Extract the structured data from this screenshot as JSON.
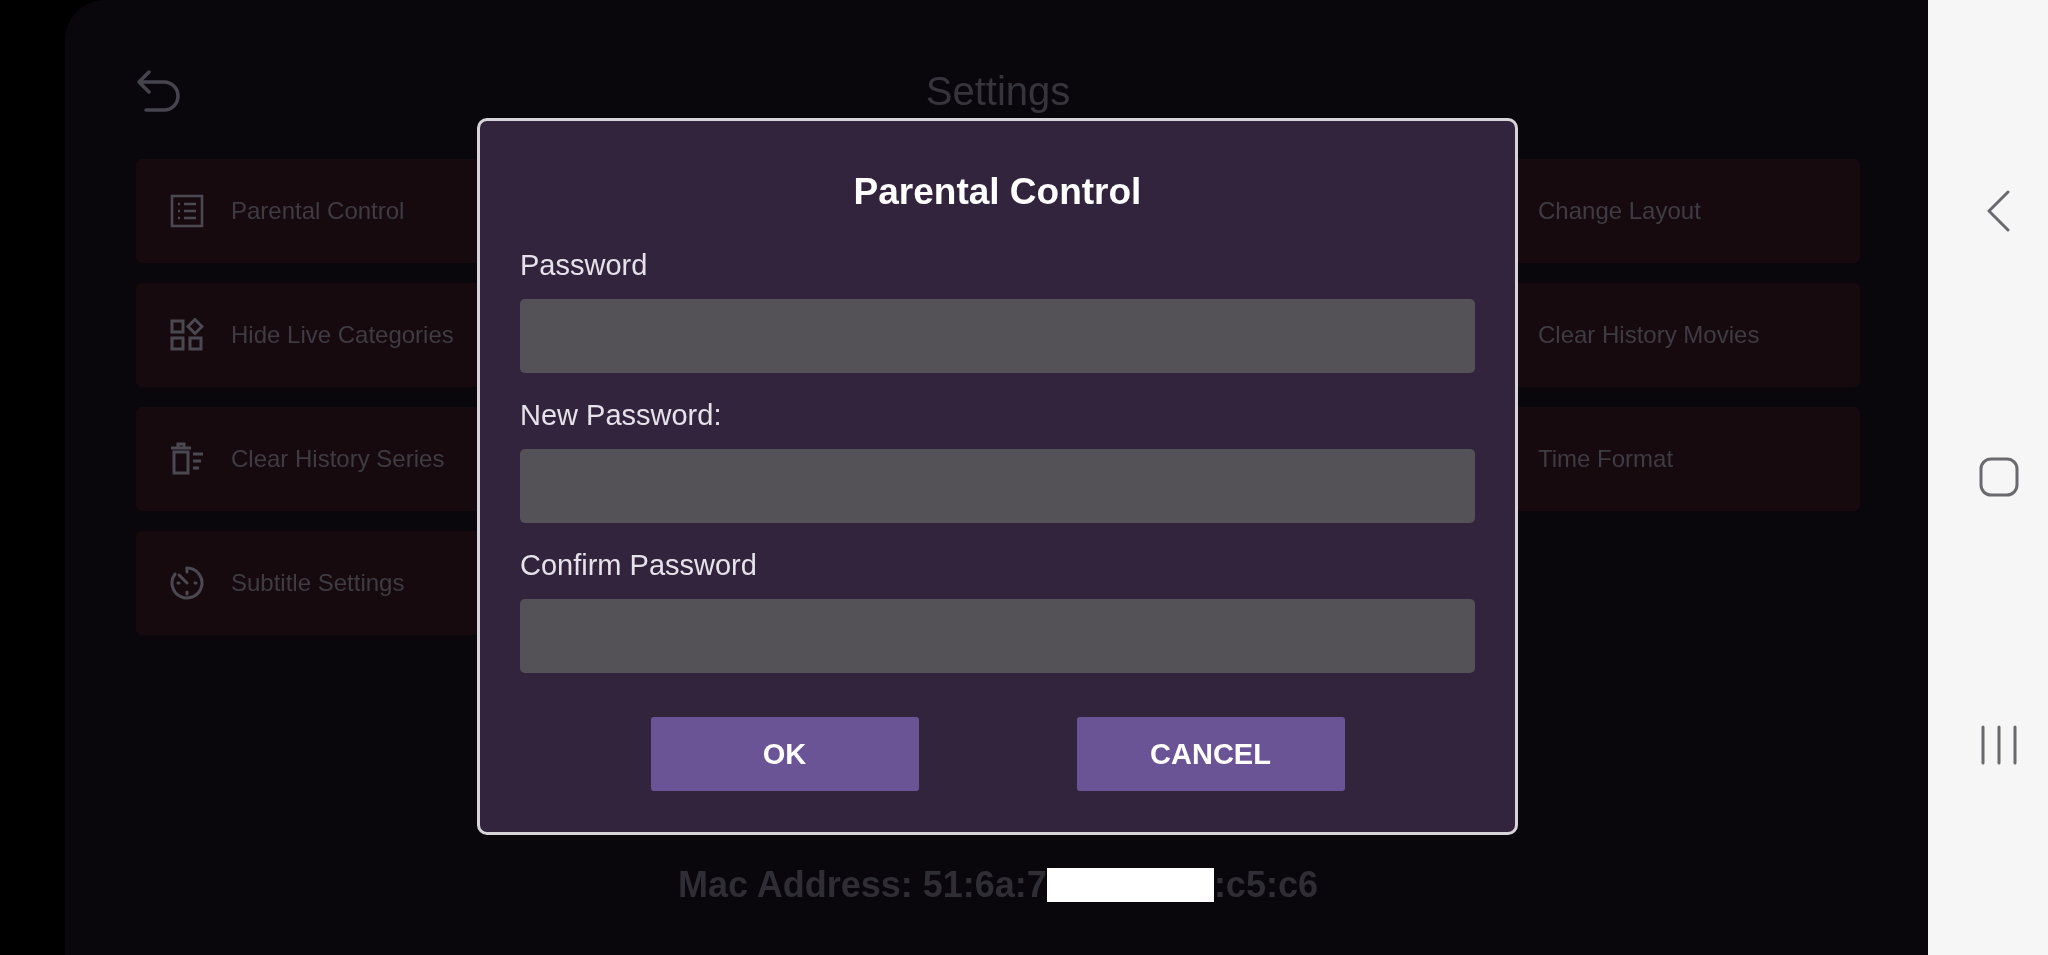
{
  "screen": {
    "title": "Settings"
  },
  "settings": {
    "columns": [
      {
        "items": [
          {
            "label": "Parental Control"
          },
          {
            "label": "Hide Live Categories"
          },
          {
            "label": "Clear History Series"
          },
          {
            "label": "Subtitle Settings"
          }
        ]
      },
      {
        "items": [
          {
            "label": "Change Layout"
          },
          {
            "label": "Clear History Movies"
          },
          {
            "label": "Time Format"
          }
        ]
      }
    ]
  },
  "mac_address": {
    "text_before": "Mac Address: 51:6a:7",
    "text_after": ":c5:c6",
    "redacted": true
  },
  "dialog": {
    "title": "Parental Control",
    "fields": [
      {
        "label": "Password"
      },
      {
        "label": "New Password:"
      },
      {
        "label": "Confirm Password"
      }
    ],
    "buttons": [
      {
        "label": "OK"
      },
      {
        "label": "CANCEL"
      }
    ]
  }
}
